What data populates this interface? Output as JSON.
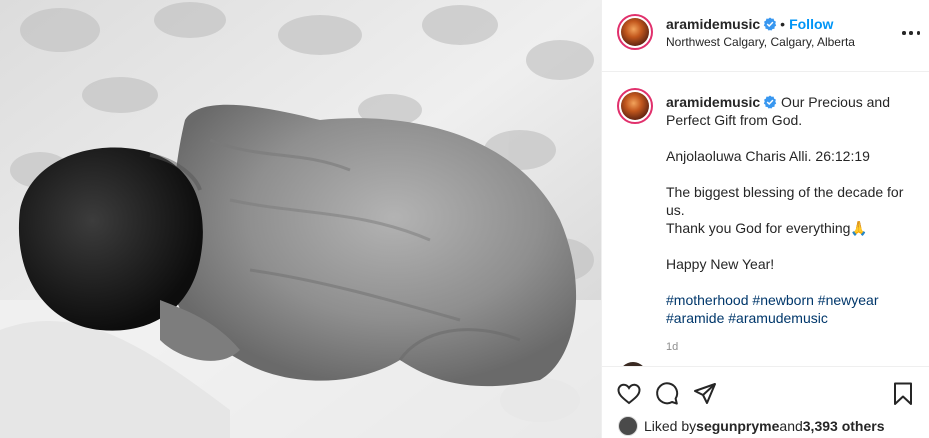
{
  "post": {
    "username": "aramidemusic",
    "verified_icon": "verified-badge-icon",
    "follow_label": "Follow",
    "separator": "•",
    "location": "Northwest Calgary, Calgary, Alberta",
    "more_icon": "more-options-icon",
    "image_alt": "black and white photo of a newborn baby sleeping curled on a blanket"
  },
  "caption": {
    "username": "aramidemusic",
    "text_first": " Our Precious and Perfect Gift from God.",
    "line2": "Anjolaoluwa Charis Alli. 26:12:19",
    "line3": "The biggest blessing of the decade for us.",
    "line4": "Thank you God for everything🙏",
    "line5": "Happy New Year!",
    "hashtags": [
      "#motherhood",
      "#newborn",
      "#newyear",
      "#aramide",
      "#aramudemusic"
    ],
    "age": "1d"
  },
  "actions": {
    "like_icon": "heart-icon",
    "comment_icon": "comment-icon",
    "share_icon": "share-icon",
    "save_icon": "bookmark-icon"
  },
  "likes": {
    "prefix": "Liked by ",
    "user": "segunpryme",
    "middle": " and ",
    "count": "3,393 others"
  },
  "colors": {
    "accent": "#0095f6",
    "hashtag": "#00376b",
    "verified": "#3897f0",
    "ring": "#e1306c"
  }
}
